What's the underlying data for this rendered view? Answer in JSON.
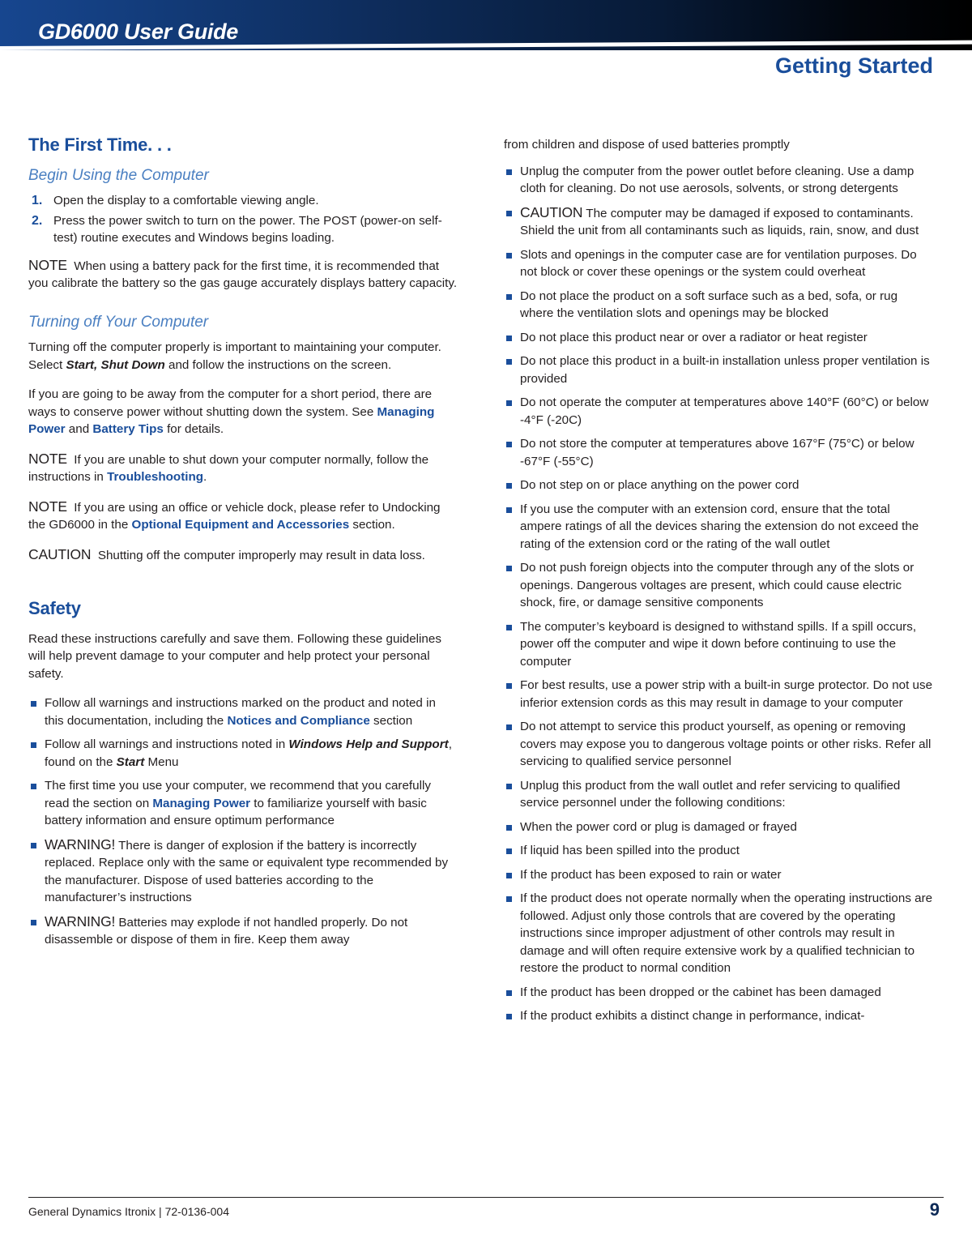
{
  "header": {
    "guide_title": "GD6000 User Guide",
    "chapter_title": "Getting Started"
  },
  "left_column": {
    "section_title": "The First Time. . .",
    "subsection_begin": "Begin Using the Computer",
    "steps": [
      "Open the display to a comfortable viewing angle.",
      "Press the power switch to turn on the power.  The POST (power-on self-test) routine executes and Windows begins loading."
    ],
    "note1_label": "NOTE",
    "note1_text": "When using a battery pack for the first time, it is recommended that you calibrate the battery so the gas gauge accurately displays battery capacity.",
    "subsection_turning_off": "Turning off Your Computer",
    "para_turning_off_a": "Turning off the computer properly is important to maintaining your computer.  Select ",
    "para_turning_off_a_bold": "Start, Shut Down",
    "para_turning_off_a_end": " and follow the instructions on the screen.",
    "para_conserve_a": "If you are going to be away from the computer for a short period, there are ways to conserve power without shutting down the system. See ",
    "para_conserve_link1": "Managing Power",
    "para_conserve_mid": " and ",
    "para_conserve_link2": "Battery Tips",
    "para_conserve_end": " for details.",
    "note2_label": "NOTE",
    "note2_text_a": "If you are unable to shut down your computer normally, follow the instructions in ",
    "note2_link": "Troubleshooting",
    "note2_text_end": ".",
    "note3_label": "NOTE",
    "note3_text_a": "If you are using an office or vehicle dock, please refer to Undocking the GD6000 in the ",
    "note3_link": "Optional Equipment and Accessories",
    "note3_text_end": " section.",
    "caution_label": "CAUTION",
    "caution_text": "Shutting off the computer improperly may result in data loss.",
    "safety_title": "Safety",
    "safety_intro": "Read these instructions carefully and save them. Following these guidelines will help prevent damage to your computer and help protect your personal safety.",
    "bullets": [
      {
        "parts": [
          {
            "t": "Follow all warnings and instructions marked on the product and noted in this documentation, including the ",
            "s": "plain"
          },
          {
            "t": "Notices and Compliance",
            "s": "link"
          },
          {
            "t": " section",
            "s": "plain"
          }
        ]
      },
      {
        "parts": [
          {
            "t": "Follow all warnings and instructions noted in ",
            "s": "plain"
          },
          {
            "t": "Windows Help and Support",
            "s": "bolditalic"
          },
          {
            "t": ", found on the ",
            "s": "plain"
          },
          {
            "t": "Start",
            "s": "bolditalic"
          },
          {
            "t": " Menu",
            "s": "plain"
          }
        ]
      },
      {
        "parts": [
          {
            "t": "The first time you use your computer, we recommend that you carefully read the section on ",
            "s": "plain"
          },
          {
            "t": "Managing Power",
            "s": "link"
          },
          {
            "t": " to familiarize yourself with basic battery information and ensure optimum performance",
            "s": "plain"
          }
        ]
      },
      {
        "parts": [
          {
            "t": "WARNING!",
            "s": "warn"
          },
          {
            "t": " There is danger of explosion if the battery is incorrectly replaced.  Replace only with the same or equivalent type recommended by the manufacturer.  Dispose of used batteries according to the manufacturer’s instructions",
            "s": "plain"
          }
        ]
      },
      {
        "parts": [
          {
            "t": "WARNING!",
            "s": "warn"
          },
          {
            "t": "  Batteries may explode if not handled properly. Do not disassemble or dispose of them in fire. Keep them away",
            "s": "plain"
          }
        ]
      }
    ]
  },
  "right_column": {
    "continued_line": "from children and dispose of used batteries promptly",
    "bullets": [
      {
        "parts": [
          {
            "t": "Unplug the computer from the power outlet before cleaning. Use a damp cloth for cleaning. Do not use aerosols, solvents, or strong detergents",
            "s": "plain"
          }
        ]
      },
      {
        "parts": [
          {
            "t": "CAUTION",
            "s": "warn"
          },
          {
            "t": " The computer may be damaged if exposed to contaminants. Shield the unit from all contaminants such as liquids, rain, snow, and dust",
            "s": "plain"
          }
        ]
      },
      {
        "parts": [
          {
            "t": "Slots and openings in the computer case are for ventilation purposes. Do not block or cover these openings or the system could overheat",
            "s": "plain"
          }
        ]
      },
      {
        "parts": [
          {
            "t": "Do not place the product on a soft surface such as a bed, sofa, or rug where the ventilation slots and openings may be blocked",
            "s": "plain"
          }
        ]
      },
      {
        "parts": [
          {
            "t": "Do not place this product  near or over a radiator or heat register",
            "s": "plain"
          }
        ]
      },
      {
        "parts": [
          {
            "t": "Do not place this product in a built-in installation unless proper ventilation is provided",
            "s": "plain"
          }
        ]
      },
      {
        "parts": [
          {
            "t": "Do not operate the computer at temperatures above 140°F (60°C) or below -4°F (-20C)",
            "s": "plain"
          }
        ]
      },
      {
        "parts": [
          {
            "t": "Do not store the computer at temperatures above 167°F (75°C) or below -67°F (-55°C)",
            "s": "plain"
          }
        ]
      },
      {
        "parts": [
          {
            "t": "Do not step on or place anything on the power cord",
            "s": "plain"
          }
        ]
      },
      {
        "parts": [
          {
            "t": "If you use the computer with an extension cord, ensure that the total ampere ratings of all the devices sharing the extension do not exceed the rating of the extension cord or the rating of the wall outlet",
            "s": "plain"
          }
        ]
      },
      {
        "parts": [
          {
            "t": "Do not push foreign objects into the computer through any of the slots or openings. Dangerous voltages are present, which could cause electric shock,  fire, or damage sensitive components",
            "s": "plain"
          }
        ]
      },
      {
        "parts": [
          {
            "t": "The computer’s keyboard is designed to withstand spills. If a spill occurs, power off the computer and wipe it down before continuing to use the computer",
            "s": "plain"
          }
        ]
      },
      {
        "parts": [
          {
            "t": "For best results, use a power strip with a built-in surge protector. Do not use inferior extension cords as this may result in damage to your computer",
            "s": "plain"
          }
        ]
      },
      {
        "parts": [
          {
            "t": "Do not attempt to service this product yourself, as opening or removing covers may expose you to dangerous voltage points or other risks. Refer all servicing to qualified service personnel",
            "s": "plain"
          }
        ]
      },
      {
        "parts": [
          {
            "t": "Unplug this product from the wall outlet and refer servicing to qualified service personnel under the following conditions:",
            "s": "plain"
          }
        ]
      },
      {
        "parts": [
          {
            "t": "When the power cord or plug is damaged or frayed",
            "s": "plain"
          }
        ]
      },
      {
        "parts": [
          {
            "t": "If liquid has been spilled into the product",
            "s": "plain"
          }
        ]
      },
      {
        "parts": [
          {
            "t": "If the product has been exposed to rain or water",
            "s": "plain"
          }
        ]
      },
      {
        "parts": [
          {
            "t": "If the product does not operate normally when the operating instructions are followed. Adjust only those controls that are covered by the operating instructions since improper adjustment of other controls may result in damage and will often require extensive work by a qualified technician to restore the product to normal condition",
            "s": "plain"
          }
        ]
      },
      {
        "parts": [
          {
            "t": "If the product has been dropped or the cabinet has been damaged",
            "s": "plain"
          }
        ]
      },
      {
        "parts": [
          {
            "t": "If the product exhibits a distinct change in performance, indicat-",
            "s": "plain"
          }
        ]
      }
    ]
  },
  "footer": {
    "left": "General Dynamics Itronix | 72-0136-004",
    "page": "9"
  },
  "colors": {
    "accent_blue": "#1a4e9b",
    "light_blue": "#4a7fc1",
    "header_dark": "#02060d"
  }
}
